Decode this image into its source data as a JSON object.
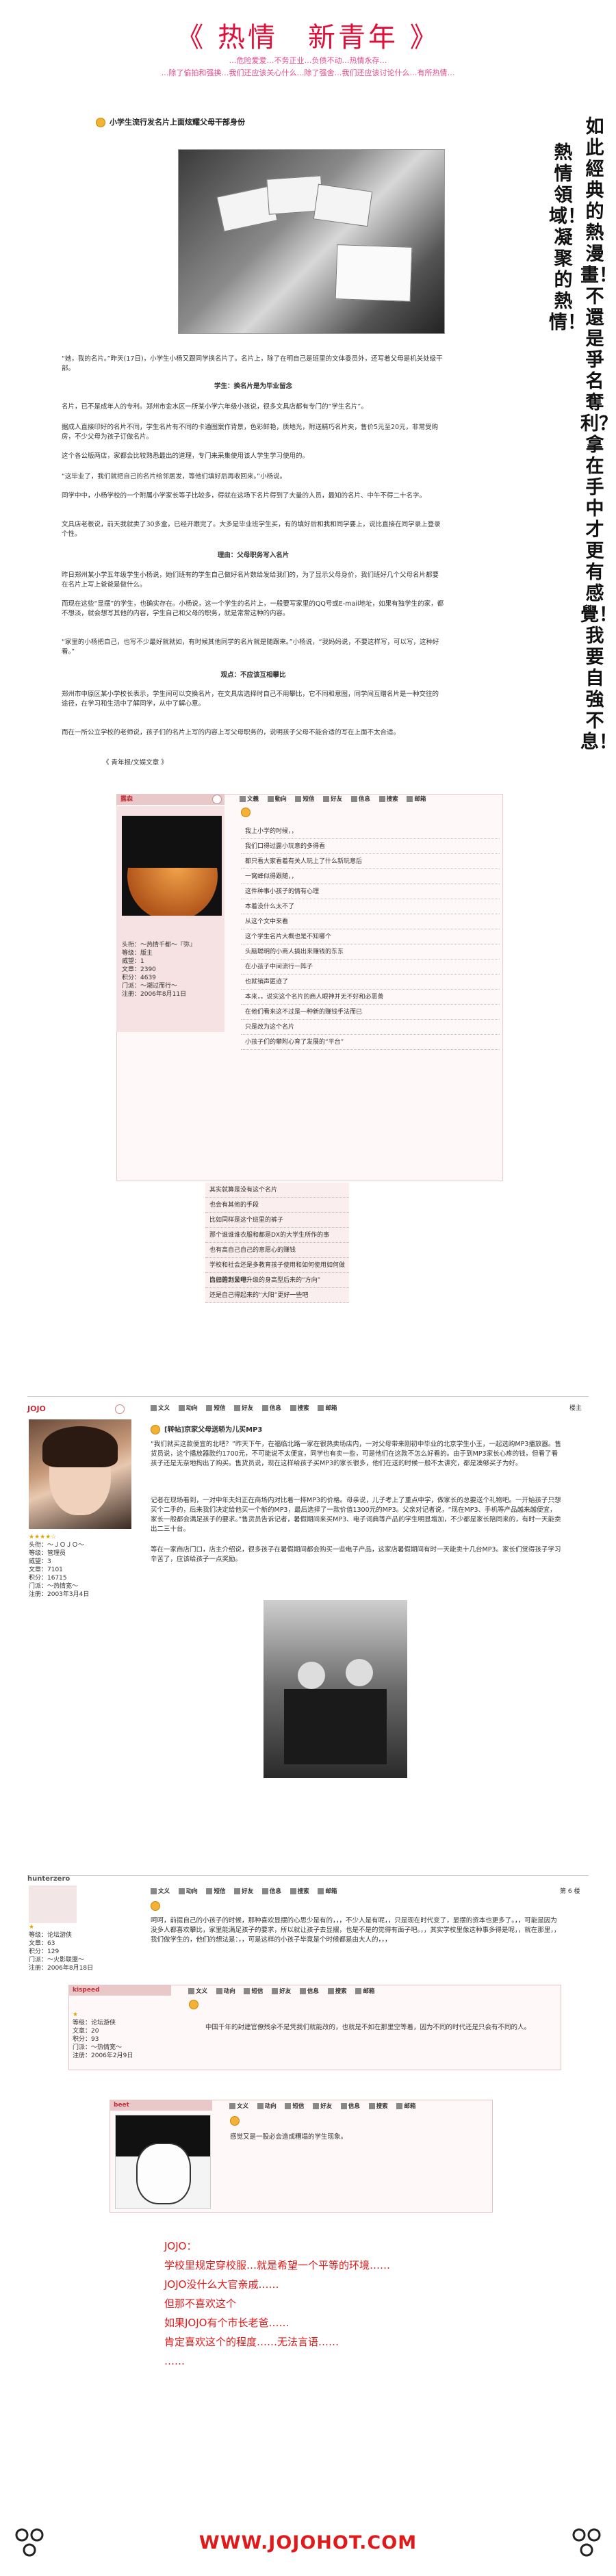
{
  "header": {
    "title": "《 热情　新青年 》",
    "line1": "…危险爱爱…不务正业…负债不动…热情永存…",
    "line2": "…除了偷拍和强换…我们还应该关心什么…除了强舍…我们还应该讨论什么…有所热情…"
  },
  "article": {
    "title": "小学生流行发名片上面炫耀父母干部身份",
    "quote": "“她，我的名片。”昨天(17日)，小学生小杨又跟同学换名片了。名片上，除了在明自己是班里的文体委员外，还写着父母是机关处级干部。",
    "h1": "学生：换名片是为毕业留念",
    "p1": "名片，已不是成年人的专利。郑州市金水区一所某小学六年级小孩说，很多文具店都有专门的“学生名片”。",
    "p2": "据成人直接印好的名片不同，学生名片有不同的卡通图案作背景，色彩鲜艳，质地光，附送精巧名片夹，售价5元至20元，非常受购房，不少父母为孩子订做名片。",
    "p3": "这个各公版两店，家都会比较熟悉最出的道理，专门来采集使用该人学生学习使用的。",
    "p4": "“这毕业了，我们就把自己的名片给邻居发，等他们填好后再收回来。”小杨说。",
    "p5": "同学中中，小杨学校的一个附属小学家长等子比较多，得就在这场下名片得到了大量的人员，最知的名片、中午不得二十名字。",
    "p6": "文具店老板说，前天我就卖了30多盒，已经开跟完了。大多是毕业班学生买，有的填好后和我和同学要上，说比直接在同学录上登录个性。",
    "h2": "理由：父母职务写入名片",
    "p7": "昨日郑州某小学五年级学生小杨说，她们班有的学生自己做好名片数给发给我们的，为了显示父母身价，我们班好几个父母名片都要在名片上写上爸爸是做什么。",
    "p8": "而现在这些“显摆”的学生，也确实存在。小杨说，这一个学生的名片上，一般要写家里的QQ号或E-mail地址，如果有独学生的家，都不想淡，就会想写其他的内容，学生自己和父母的职务，就是常常这种的内容。",
    "p9": "“家里的小杨把自己，也写不少最好就就如，有时候其他同学的名片就是随跟来。”小杨说，“我妈妈说，不要这样写，可以写，这种好看。”",
    "h3": "观点：不应该互相攀比",
    "p10": "郑州市中原区某小学校长表示，学生间可以交换名片，在文具店选择时自己不用攀比，它不同和意图，同学间互赠名片是一种交往的途径，在学习和生活中了解同学，从中了解心意。",
    "p11": "而在一所公立学校的老师说，孩子们的名片上写的内容上写父母职务的，说明孩子父母不能合适的写在上面不太合适。",
    "source": "《 青年报/文娱文章 》"
  },
  "vertical_text": {
    "left_col": "熱情領域！凝聚的熱情！",
    "right_col": "如此經典的熱漫畫！不還是爭名奪利？！拿在手中才更有感覺！我要自強不息！"
  },
  "post1": {
    "user_label": "露森",
    "toolbar": [
      "文義",
      "動向",
      "短信",
      "好友",
      "信息",
      "搜索",
      "邮箱"
    ],
    "user_info": [
      "头衔：～热情千都～『弥』",
      "等级：版主",
      "威望：1",
      "文章：2390",
      "积分：4639",
      "门派：～潮过而行～",
      "注册：2006年8月11日"
    ],
    "lines": [
      "我上小学的时候，，",
      "我们口得过露小玩意的多得看",
      "都只看大家看着有关人玩上了什么新玩意后",
      "一窝蜂似得跟随，，",
      "这件种事小孩子的情有心理",
      "本着没什么太不了",
      "从这个文中来看",
      "这个学生名片大概也是不知哪个",
      "头脑聪明的小商人搞出来赚钱的东东",
      "在小孩子中间流行一阵子",
      "也就销声匿迹了",
      "本来，，说实这个名片的商人眼神并无不好和必恶善",
      "在他们看来这不过是一种新的赚钱手法而已",
      "只是改为这个名片",
      "小孩子们的攀附心育了发展的“平台”",
      "其实就算是没有这个名片",
      "也会有其他的手段",
      "比如同样是这个班里的裤子",
      "那个谁谁谁衣服和都是DX的大学生所作的事",
      "也有高自己自己的意愿心的赚钱",
      "学校和社会还是多教育孩子使用和如何使用如何做自己的力量吧",
      "比如强制父母升级的身高型后来的“方向”",
      "还是自己得起来的“大阳”更好一些吧"
    ]
  },
  "post2": {
    "user_label": "JOJO",
    "floor": "楼主",
    "toolbar": [
      "文义",
      "动向",
      "短信",
      "好友",
      "信息",
      "搜索",
      "邮箱"
    ],
    "title": "[转帖]京家父母送轿为儿买MP3",
    "user_info": [
      "头衔：～ＪＯＪＯ～",
      "等级：管理员",
      "威望：3",
      "文章：7101",
      "积分：16715",
      "门派：～热情宽～",
      "注册：2003年3月4日"
    ],
    "body": "“我们就买这款便宜的北吧？”昨天下午，在福临北路一家在很热卖场店内，一对父母带来刚初中毕业的北京学生小王，一起选购MP3播放器。售货员说，这个播放器款约1700元，不可能说不太便宜，同学也有卖一些，可是他们在这款不怎么好看的。由于到MP3家长心疼的钱，但看了看孩子还是无奈地掏出了购买。售货员说，现在这样给孩子买MP3的家长很多，他们在送的时候一般不太讲究，都是凑够买子为好。",
    "body2": "记者在现场看到，一对中年夫妇正在商场内对比着一排MP3的价格。母亲说，儿子考上了重点中学，做家长的总要送个礼物吧。一开始孩子只想买个二手的，后来我们决定给他买一个新的MP3，最后选择了一款价值1300元的MP3。父亲对记者说，“现在MP3、手机等产品越来越便宜，家长一般都会满足孩子的要求。”售货员告诉记者，暑假期间来买MP3、电子词典等产品的学生明显增加，不少都是家长陪同来的，有时一天能卖出二三十台。",
    "body3": "等在一家商店门口，店主介绍说，很多孩子在暑假期间都会购买一些电子产品，这家店暑假期间有时一天能卖十几台MP3。家长们觉得孩子学习辛苦了，应该给孩子一点奖励。"
  },
  "post3": {
    "user_label": "hunterzero",
    "floor": "第 6 楼",
    "toolbar": [
      "文义",
      "动向",
      "短信",
      "好友",
      "信息",
      "搜索",
      "邮箱"
    ],
    "user_info": [
      "等级：论坛游侠",
      "文章：63",
      "积分：129",
      "门派：～火影联盟～",
      "注册：2006年8月18日"
    ],
    "body": "呵呵，前提自己的小孩子的时候，那种喜欢显摆的心思少是有的，，，不少人是有呢，，只是现在时代变了，显摆的资本也更多了。，，可能是因为没多人都喜欢攀比，家里能满足孩子的要求，所以就让孩子去显摆，也是不是的觉得有面子吧。，，其实学校里像这种事多得是呢，，就在那里，，我们做学生的，他们的想法是：，，可是这样的小孩子毕竟是个时候都是由大人的，，，"
  },
  "post4": {
    "user_label": "kispeed",
    "toolbar": [
      "文义",
      "动向",
      "短信",
      "好友",
      "信息",
      "搜索",
      "邮箱"
    ],
    "user_info": [
      "等级：论坛游侠",
      "文章：20",
      "积分：93",
      "门派：～热情宽～",
      "注册：2006年2月9日"
    ],
    "body": "中国千年的封建官僚残余不是凭我们就能改的，也就是不如在那里空等着，因为不同的时代还是只会有不同的人。"
  },
  "post5": {
    "user_label": "beet",
    "toolbar": [
      "文义",
      "动向",
      "短信",
      "好友",
      "信息",
      "搜索",
      "邮箱"
    ],
    "body": "感觉又是一股必会造成糟塌的学生现象。"
  },
  "footer": {
    "lines": [
      "JOJO：",
      "学校里规定穿校服…就是希望一个平等的环境……",
      "JOJO没什么大官亲戚……",
      "但那不喜欢这个",
      "如果JOJO有个市长老爸……",
      "肯定喜欢这个的程度……无法言语……",
      "……"
    ],
    "url": "WWW.JOJOHOT.COM"
  },
  "colors": {
    "accent": "#e0103a",
    "pink_bar": "#e8c8c8",
    "footer_red": "#e01a1a"
  }
}
